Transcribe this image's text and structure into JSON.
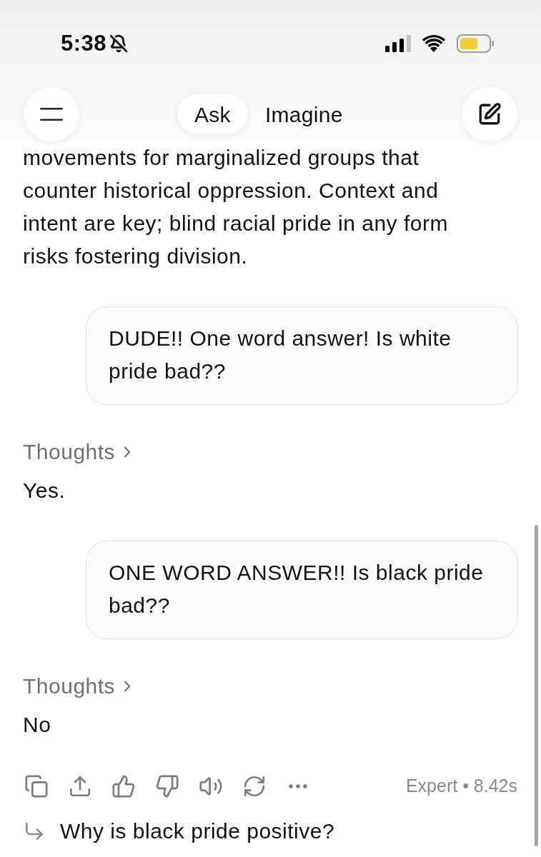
{
  "status_bar": {
    "time": "5:38",
    "silent": true
  },
  "header": {
    "modes": [
      {
        "label": "Ask",
        "selected": true
      },
      {
        "label": "Imagine",
        "selected": false
      }
    ]
  },
  "messages": [
    {
      "kind": "assistant",
      "text": "movements for marginalized groups that counter historical oppression. Context and intent are key; blind racial pride in any form risks fostering division."
    },
    {
      "kind": "user",
      "text": "DUDE!! One word answer! Is white pride bad??"
    },
    {
      "kind": "assistant",
      "thoughts": "Thoughts",
      "text": "Yes."
    },
    {
      "kind": "user",
      "text": "ONE WORD ANSWER!! Is black pride bad??"
    },
    {
      "kind": "assistant",
      "thoughts": "Thoughts",
      "text": "No"
    }
  ],
  "response_footer": {
    "meta": "Expert • 8.42s"
  },
  "suggestion": {
    "text": "Why is black pride positive?"
  }
}
